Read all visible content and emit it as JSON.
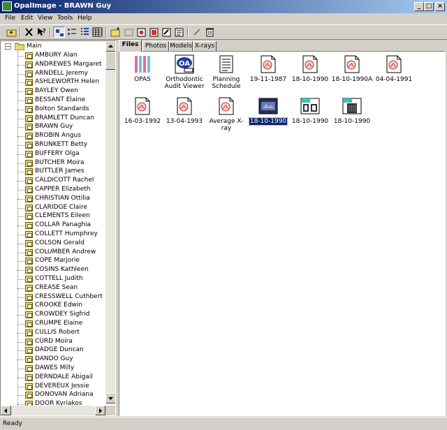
{
  "window": {
    "title": "OpalImage - BRAWN Guy"
  },
  "menu": [
    "File",
    "Edit",
    "View",
    "Tools",
    "Help"
  ],
  "tree": {
    "root": "Main",
    "items": [
      "AMBURY Alan",
      "ANDREWES Margaret",
      "ARNDELL Jeremy",
      "ASHLEWORTH Helen",
      "BAYLEY Owen",
      "BESSANT Elaine",
      "Bolton Standards",
      "BRAMLETT Duncan",
      "BRAWN Guy",
      "BROBIN Angus",
      "BRUNKETT Betty",
      "BUFFERY Olga",
      "BUTCHER Moira",
      "BUTTLER James",
      "CALDICOTT Rachel",
      "CAPPER Elizabeth",
      "CHRISTIAN Ottilia",
      "CLARIDGE Claire",
      "CLEMENTS Eileen",
      "COLLAR Panaghia",
      "COLLETT Humphrey",
      "COLSON Gerald",
      "COLUMBER Andrew",
      "COPE Marjorie",
      "COSINS Kathleen",
      "COTTELL Judith",
      "CREASE Sean",
      "CRESSWELL Cuthbert",
      "CROOKE Edwin",
      "CROWDEY Sigfrid",
      "CRUMPE Elaine",
      "CULLIS Robert",
      "CURD Moira",
      "DADGE Duncan",
      "DANDO Guy",
      "DAWES Milly",
      "DERNDALE Abigail",
      "DEVEREUX Jessie",
      "DONOVAN Adriana",
      "DOOR Kyriakos"
    ]
  },
  "tabs": [
    "Files",
    "Photos",
    "Models",
    "X-rays"
  ],
  "files": [
    {
      "label": "OPAS",
      "icon": "opas-app-icon"
    },
    {
      "label": "Orthodontic Audit Viewer",
      "icon": "oa-viewer-icon"
    },
    {
      "label": "Planning Schedule",
      "icon": "document-icon"
    },
    {
      "label": "19-11-1987",
      "icon": "xray-image-icon"
    },
    {
      "label": "18-10-1990",
      "icon": "xray-image-icon"
    },
    {
      "label": "18-10-1990A",
      "icon": "xray-image-icon"
    },
    {
      "label": "04-04-1991",
      "icon": "xray-image-icon"
    },
    {
      "label": "16-03-1992",
      "icon": "xray-image-icon"
    },
    {
      "label": "13-04-1993",
      "icon": "xray-image-icon"
    },
    {
      "label": "Average X-ray",
      "icon": "xray-image-icon"
    },
    {
      "label": "18-10-1990",
      "icon": "photo-image-icon"
    },
    {
      "label": "18-10-1990",
      "icon": "model-image-icon"
    },
    {
      "label": "18-10-1990",
      "icon": "scan-image-icon"
    }
  ],
  "status": {
    "text": "Ready"
  },
  "colors": {
    "title_bar": "#0a246a",
    "selection": "#0a246a",
    "face": "#d4d0c8"
  }
}
